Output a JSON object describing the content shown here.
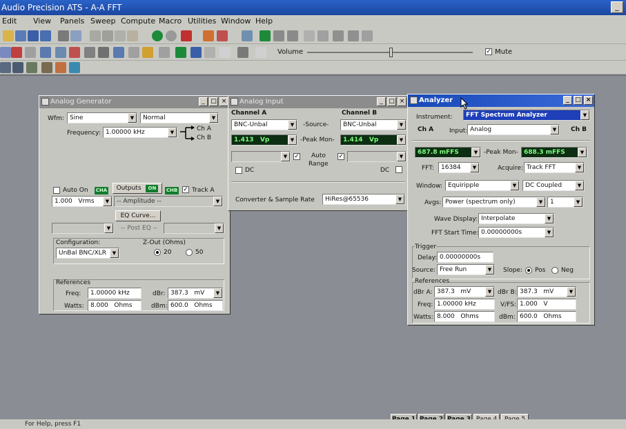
{
  "app": {
    "title": "Audio Precision ATS - A-A FFT"
  },
  "menu": [
    "Edit",
    "View",
    "Panels",
    "Sweep",
    "Compute",
    "Macro",
    "Utilities",
    "Window",
    "Help"
  ],
  "toolbar": {
    "volume_label": "Volume",
    "mute_label": "Mute",
    "mute_checked": true
  },
  "generator": {
    "title": "Analog Generator",
    "wfm_label": "Wfm:",
    "wfm_value": "Sine",
    "wfm_mode": "Normal",
    "freq_label": "Frequency:",
    "freq_value": "1.00000 kHz",
    "cha": "Ch A",
    "chb": "Ch B",
    "auto_on": "Auto On",
    "cha_badge": "CHA",
    "outputs": "Outputs",
    "on_badge": "ON",
    "chb_badge": "CHB",
    "track_a": "Track A",
    "ampl_value": "1.000",
    "ampl_unit": "Vrms",
    "ampl_b": "-- Amplitude --",
    "eq_curve": "EQ Curve...",
    "post_eq": "-- Post EQ --",
    "config_label": "Configuration:",
    "config_value": "UnBal BNC/XLR",
    "zout_label": "Z-Out (Ohms)",
    "z20": "20",
    "z50": "50",
    "refs_label": "References",
    "freq_ref_label": "Freq:",
    "freq_ref": "1.00000 kHz",
    "dbr_label": "dBr:",
    "dbr_value": "387.3",
    "dbr_unit": "mV",
    "watts_label": "Watts:",
    "watts_value": "8.000",
    "watts_unit": "Ohms",
    "dbm_label": "dBm:",
    "dbm_value": "600.0",
    "dbm_unit": "Ohms"
  },
  "input": {
    "title": "Analog Input",
    "cha_label": "Channel A",
    "chb_label": "Channel B",
    "source_label": "-Source-",
    "cha_source": "BNC-Unbal",
    "chb_source": "BNC-Unbal",
    "peak_label": "-Peak Mon-",
    "cha_peak": "1.413",
    "cha_peak_unit": "Vp",
    "chb_peak": "1.414",
    "chb_peak_unit": "Vp",
    "auto": "Auto",
    "range": "Range",
    "dc": "DC",
    "conv_label": "Converter & Sample Rate",
    "conv_value": "HiRes@65536"
  },
  "analyzer": {
    "title": "Analyzer",
    "instrument_label": "Instrument:",
    "instrument_value": "FFT Spectrum Analyzer",
    "cha_label": "Ch A",
    "chb_label": "Ch B",
    "input_label": "Input:",
    "input_value": "Analog",
    "cha_level": "687.8",
    "cha_level_unit": "mFFS",
    "peak_label": "-Peak Mon-",
    "chb_level": "688.3",
    "chb_level_unit": "mFFS",
    "fft_label": "FFT:",
    "fft_value": "16384",
    "acquire_label": "Acquire:",
    "acquire_value": "Track FFT",
    "window_label": "Window:",
    "window_value": "Equiripple",
    "coupling_value": "DC Coupled",
    "avgs_label": "Avgs:",
    "avgs_value": "Power (spectrum only)",
    "avgs_count": "1",
    "wave_label": "Wave Display:",
    "wave_value": "Interpolate",
    "start_label": "FFT Start Time:",
    "start_value": "0.00000000s",
    "trigger_label": "Trigger",
    "delay_label": "Delay:",
    "delay_value": "0.00000000s",
    "source_label": "Source:",
    "source_value": "Free Run",
    "slope_label": "Slope:",
    "pos": "Pos",
    "neg": "Neg",
    "refs_label": "References",
    "dbra_label": "dBr A:",
    "dbra_value": "387.3",
    "dbra_unit": "mV",
    "dbrb_label": "dBr B:",
    "dbrb_value": "387.3",
    "dbrb_unit": "mV",
    "freq_label": "Freq:",
    "freq_value": "1.00000 kHz",
    "vfs_label": "V/FS:",
    "vfs_value": "1.000",
    "vfs_unit": "V",
    "watts_label": "Watts:",
    "watts_value": "8.000",
    "watts_unit": "Ohms",
    "dbm_label": "dBm:",
    "dbm_value": "600.0",
    "dbm_unit": "Ohms"
  },
  "pages": [
    "Page 1",
    "Page 2",
    "Page 3",
    "Page 4",
    "Page 5"
  ],
  "status": "For Help, press F1"
}
